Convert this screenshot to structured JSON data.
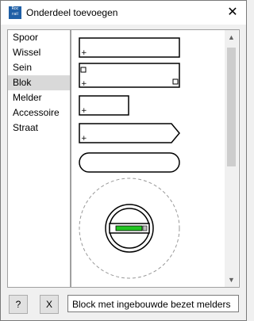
{
  "window": {
    "title": "Onderdeel toevoegen",
    "app_icon_text_top": "Roc",
    "app_icon_text_bottom": "rail",
    "close_label": "✕"
  },
  "sidebar": {
    "items": [
      {
        "label": "Spoor"
      },
      {
        "label": "Wissel"
      },
      {
        "label": "Sein"
      },
      {
        "label": "Blok",
        "selected": true
      },
      {
        "label": "Melder"
      },
      {
        "label": "Accessoire"
      },
      {
        "label": "Straat"
      }
    ]
  },
  "canvas": {
    "scroll_up": "▲",
    "scroll_down": "▼"
  },
  "footer": {
    "help_label": "?",
    "cancel_label": "X",
    "status_text": "Block met ingebouwde bezet melders"
  },
  "colors": {
    "accent_green": "#22c422",
    "selection": "#d9d9d9"
  }
}
